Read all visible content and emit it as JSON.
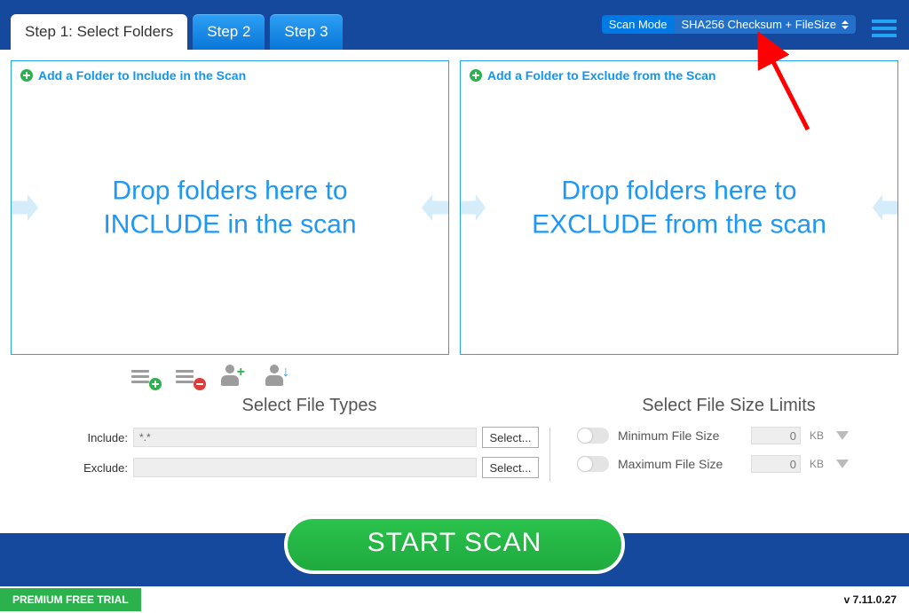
{
  "tabs": {
    "step1": "Step 1: Select Folders",
    "step2": "Step 2",
    "step3": "Step 3"
  },
  "scanMode": {
    "label": "Scan Mode",
    "value": "SHA256 Checksum + FileSize"
  },
  "includePanel": {
    "addLink": "Add a Folder to Include in the Scan",
    "dropText": "Drop folders here to INCLUDE in the scan"
  },
  "excludePanel": {
    "addLink": "Add a Folder to Exclude from the Scan",
    "dropText": "Drop folders here to EXCLUDE from the scan"
  },
  "fileTypes": {
    "title": "Select File Types",
    "includeLabel": "Include:",
    "includeValue": "*.*",
    "excludeLabel": "Exclude:",
    "excludeValue": "",
    "selectBtn": "Select..."
  },
  "sizeLimits": {
    "title": "Select File Size Limits",
    "minLabel": "Minimum File Size",
    "maxLabel": "Maximum File Size",
    "minValue": "0",
    "maxValue": "0",
    "unit": "KB"
  },
  "startScan": "START SCAN",
  "footer": {
    "badge": "PREMIUM FREE TRIAL",
    "version": "v 7.11.0.27"
  }
}
